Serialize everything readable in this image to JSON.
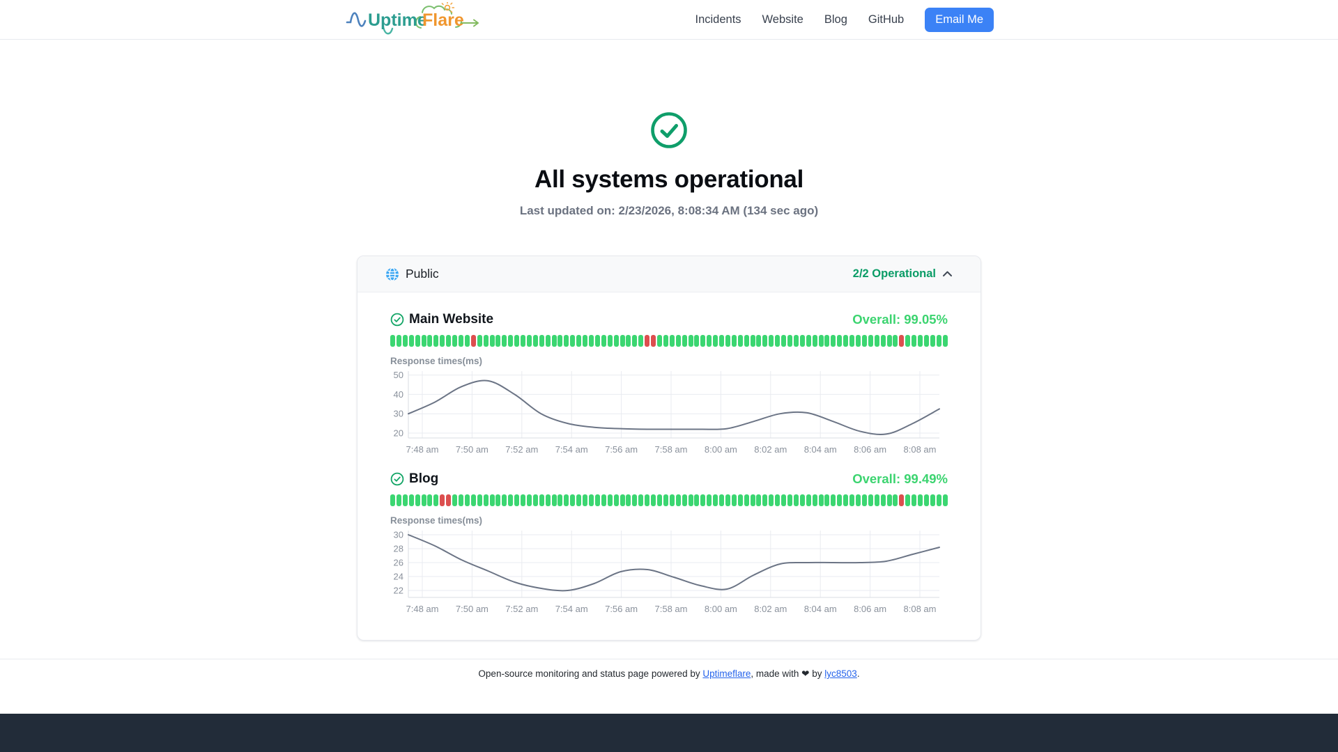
{
  "nav": {
    "logo": {
      "text_primary": "Uptime",
      "text_secondary": "Flare"
    },
    "links": [
      "Incidents",
      "Website",
      "Blog",
      "GitHub"
    ],
    "cta_label": "Email Me"
  },
  "hero": {
    "title": "All systems operational",
    "subtitle": "Last updated on: 2/23/2026, 8:08:34 AM (134 sec ago)"
  },
  "group": {
    "name": "Public",
    "status": "2/2 Operational",
    "collapsed": false
  },
  "monitors": [
    {
      "name": "Main Website",
      "overall": "Overall: 99.05%",
      "bars": {
        "total": 90,
        "down_indices": [
          13,
          41,
          42,
          82
        ]
      }
    },
    {
      "name": "Blog",
      "overall": "Overall: 99.49%",
      "bars": {
        "total": 90,
        "down_indices": [
          8,
          9,
          82
        ]
      }
    }
  ],
  "chart_data": [
    {
      "type": "line",
      "title": "Response times(ms)",
      "monitor": "Main Website",
      "x": [
        "7:48 am",
        "7:49 am",
        "7:50 am",
        "7:51 am",
        "7:52 am",
        "7:53 am",
        "7:54 am",
        "7:55 am",
        "7:56 am",
        "7:57 am",
        "7:58 am",
        "7:59 am",
        "8:00 am",
        "8:01 am",
        "8:02 am",
        "8:03 am",
        "8:04 am",
        "8:05 am",
        "8:06 am",
        "8:07 am",
        "8:08 am"
      ],
      "values": [
        30,
        36,
        44,
        47,
        40,
        30,
        25,
        23,
        22.3,
        22,
        22,
        22,
        22.3,
        26,
        30,
        30.5,
        26,
        21,
        19.5,
        25,
        32.5
      ],
      "xticklabels": [
        "7:48 am",
        "7:50 am",
        "7:52 am",
        "7:54 am",
        "7:56 am",
        "7:58 am",
        "8:00 am",
        "8:02 am",
        "8:04 am",
        "8:06 am",
        "8:08 am"
      ],
      "yticks": [
        20,
        30,
        40,
        50
      ],
      "ylim": [
        17.5,
        52
      ],
      "grid": true,
      "legend": false
    },
    {
      "type": "line",
      "title": "Response times(ms)",
      "monitor": "Blog",
      "x": [
        "7:48 am",
        "7:49 am",
        "7:50 am",
        "7:51 am",
        "7:52 am",
        "7:53 am",
        "7:54 am",
        "7:55 am",
        "7:56 am",
        "7:57 am",
        "7:58 am",
        "7:59 am",
        "8:00 am",
        "8:01 am",
        "8:02 am",
        "8:03 am",
        "8:04 am",
        "8:05 am",
        "8:06 am",
        "8:07 am",
        "8:08 am"
      ],
      "values": [
        30,
        28.4,
        26.4,
        24.8,
        23.2,
        22.3,
        22,
        23,
        24.7,
        25,
        23.9,
        22.7,
        22.2,
        24.2,
        25.8,
        26,
        26,
        26,
        26.2,
        27.2,
        28.2
      ],
      "xticklabels": [
        "7:48 am",
        "7:50 am",
        "7:52 am",
        "7:54 am",
        "7:56 am",
        "7:58 am",
        "8:00 am",
        "8:02 am",
        "8:04 am",
        "8:06 am",
        "8:08 am"
      ],
      "yticks": [
        22,
        24,
        26,
        28,
        30
      ],
      "ylim": [
        21,
        30.6
      ],
      "grid": true,
      "legend": false
    }
  ],
  "footer": {
    "text_before": "Open-source monitoring and status page powered by ",
    "link1": "Uptimeflare",
    "text_mid": ", made with ❤ by ",
    "link2": "lyc8503",
    "text_after": "."
  },
  "colors": {
    "accent_blue": "#3b82f6",
    "bar_up_green": "#3bd671",
    "bar_down_red": "#dc4f4f",
    "status_green": "#0a9c66",
    "overall_green": "#3cd470",
    "chart_line": "#6b7485",
    "globe_blue": "#3ba6f2"
  }
}
